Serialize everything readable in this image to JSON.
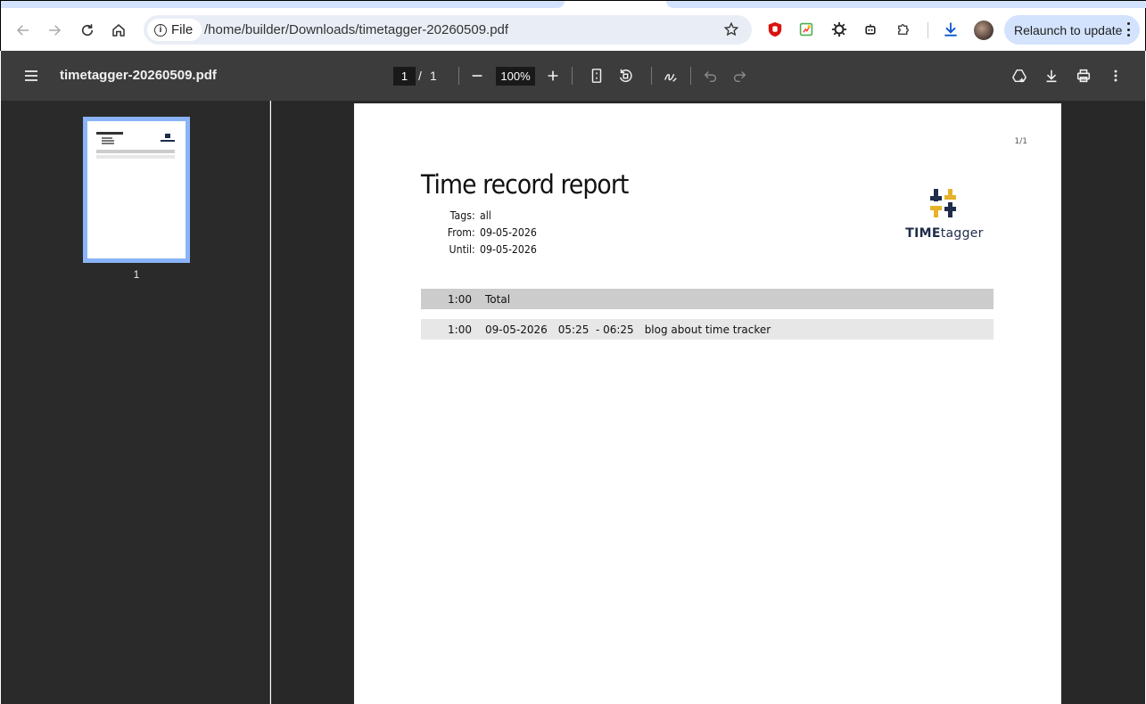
{
  "browser": {
    "omnibox": {
      "scheme_label": "File",
      "url": "/home/builder/Downloads/timetagger-20260509.pdf"
    },
    "relaunch_label": "Relaunch to update",
    "icons": [
      "back-icon",
      "forward-icon",
      "reload-icon",
      "home-icon",
      "info-icon",
      "bookmark-star-icon",
      "ublock-icon",
      "color-extension-icon",
      "sun-extension-icon",
      "robot-extension-icon",
      "extensions-puzzle-icon",
      "download-icon",
      "profile-avatar",
      "more-vert-icon"
    ]
  },
  "pdf_toolbar": {
    "title": "timetagger-20260509.pdf",
    "current_page": "1",
    "page_separator": "/",
    "total_pages": "1",
    "zoom": "100%"
  },
  "sidebar": {
    "thumbnails": [
      {
        "label": "1"
      }
    ]
  },
  "document": {
    "page_indicator": "1/1",
    "title": "Time record report",
    "meta": [
      {
        "key": "Tags:",
        "value": "all"
      },
      {
        "key": "From:",
        "value": "09-05-2026"
      },
      {
        "key": "Until:",
        "value": "09-05-2026"
      }
    ],
    "logo": {
      "bold": "TIME",
      "light": "tagger"
    },
    "total_row": {
      "duration": "1:00",
      "label": "Total"
    },
    "entries": [
      {
        "duration": "1:00",
        "date": "09-05-2026",
        "time_range": "05:25  - 06:25",
        "description": "blog about time tracker"
      }
    ]
  },
  "colors": {
    "tab_strip": "#d3e3fd",
    "toolbar": "#3c3c3c",
    "sidebar": "#2a2a2a",
    "viewer_bg": "#282828",
    "thumb_highlight": "#8ab4f8",
    "logo_gold": "#e5b22a",
    "logo_navy": "#1f2c4a"
  }
}
